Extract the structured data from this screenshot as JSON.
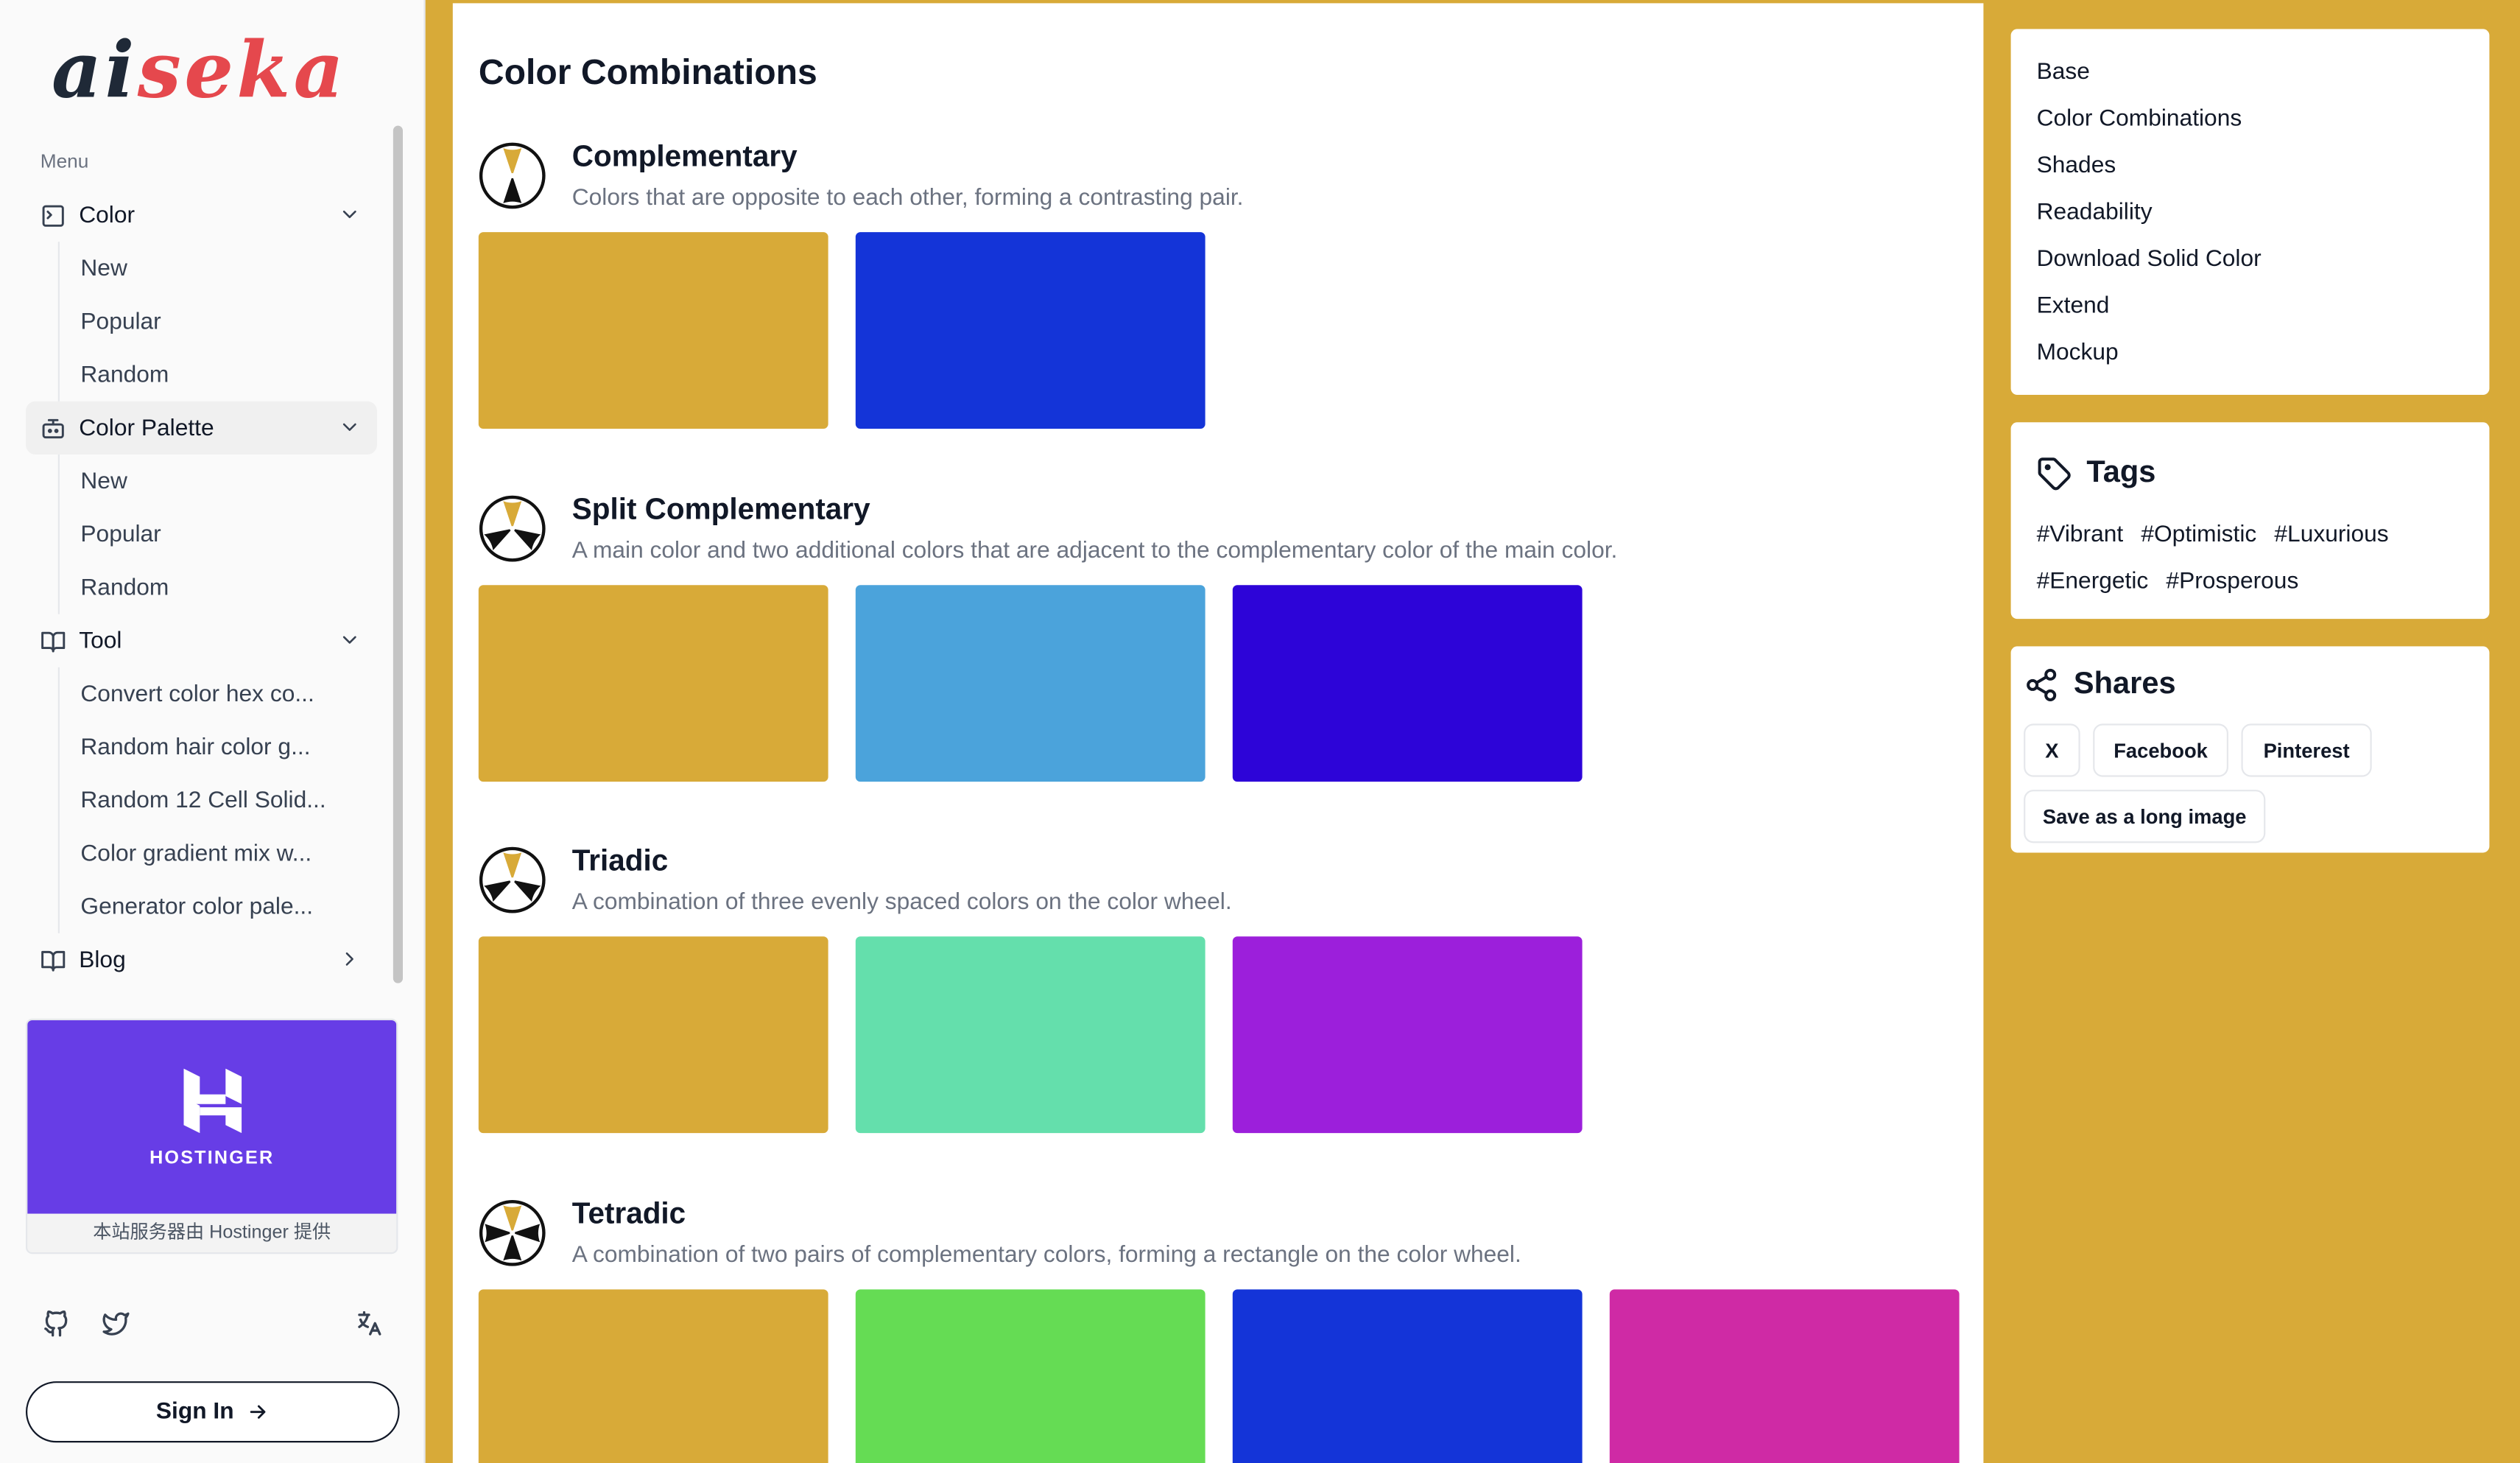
{
  "logo": {
    "part1": "ai",
    "part2": "seka"
  },
  "sidebar": {
    "menu_label": "Menu",
    "groups": [
      {
        "label": "Color",
        "icon": "palette-square-icon",
        "expanded": true,
        "items": [
          "New",
          "Popular",
          "Random"
        ]
      },
      {
        "label": "Color Palette",
        "icon": "bot-icon",
        "expanded": true,
        "items": [
          "New",
          "Popular",
          "Random"
        ]
      },
      {
        "label": "Tool",
        "icon": "book-open-icon",
        "expanded": true,
        "items": [
          "Convert color hex co...",
          "Random hair color g...",
          "Random 12 Cell Solid...",
          "Color gradient mix w...",
          "Generator color pale..."
        ]
      },
      {
        "label": "Blog",
        "icon": "book-open-icon",
        "expanded": false,
        "items": []
      }
    ],
    "ad": {
      "brand": "HOSTINGER",
      "caption": "本站服务器由 Hostinger 提供"
    },
    "footer_icons": [
      "github-icon",
      "twitter-icon",
      "language-icon"
    ],
    "signin_label": "Sign In"
  },
  "main": {
    "title": "Color Combinations",
    "sections": [
      {
        "title": "Complementary",
        "description": "Colors that are opposite to each other, forming a contrasting pair.",
        "colors": [
          "#d8aa38",
          "#1434d8"
        ]
      },
      {
        "title": "Split Complementary",
        "description": "A main color and two additional colors that are adjacent to the complementary color of the main color.",
        "colors": [
          "#d8aa38",
          "#4ba3db",
          "#2d04d8"
        ]
      },
      {
        "title": "Triadic",
        "description": "A combination of three evenly spaced colors on the color wheel.",
        "colors": [
          "#d8aa38",
          "#64dfac",
          "#9c1fdb"
        ]
      },
      {
        "title": "Tetradic",
        "description": "A combination of two pairs of complementary colors, forming a rectangle on the color wheel.",
        "colors": [
          "#d8aa38",
          "#65dc54",
          "#1434d8",
          "#cf2aa5"
        ]
      }
    ]
  },
  "right": {
    "toc": [
      "Base",
      "Color Combinations",
      "Shades",
      "Readability",
      "Download Solid Color",
      "Extend",
      "Mockup"
    ],
    "tags": {
      "title": "Tags",
      "items": [
        "#Vibrant",
        "#Optimistic",
        "#Luxurious",
        "#Energetic",
        "#Prosperous"
      ]
    },
    "shares": {
      "title": "Shares",
      "buttons": [
        "X",
        "Facebook",
        "Pinterest",
        "Save as a long image"
      ]
    }
  },
  "colors": {
    "background": "#d8aa38",
    "brand_red": "#e5484d",
    "hostinger": "#673de6"
  }
}
